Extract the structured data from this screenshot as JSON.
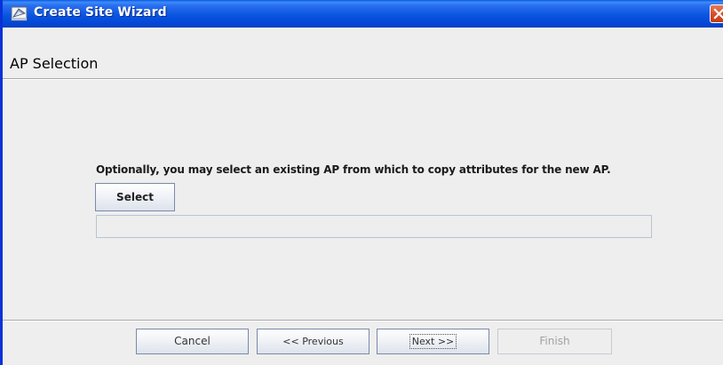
{
  "window": {
    "title": "Create Site Wizard",
    "titlebar_color": "#0a55e0",
    "close_icon": "close-x-icon",
    "app_icon": "wizard-app-icon"
  },
  "header": {
    "page_title": "AP Selection"
  },
  "content": {
    "instruction": "Optionally, you may select an existing AP from which to copy attributes for the new AP.",
    "select_label": "Select",
    "selected_ap_value": ""
  },
  "footer": {
    "cancel_label": "Cancel",
    "previous_label": "<< Previous",
    "next_label": "Next >>",
    "finish_label": "Finish",
    "finish_enabled": false
  }
}
